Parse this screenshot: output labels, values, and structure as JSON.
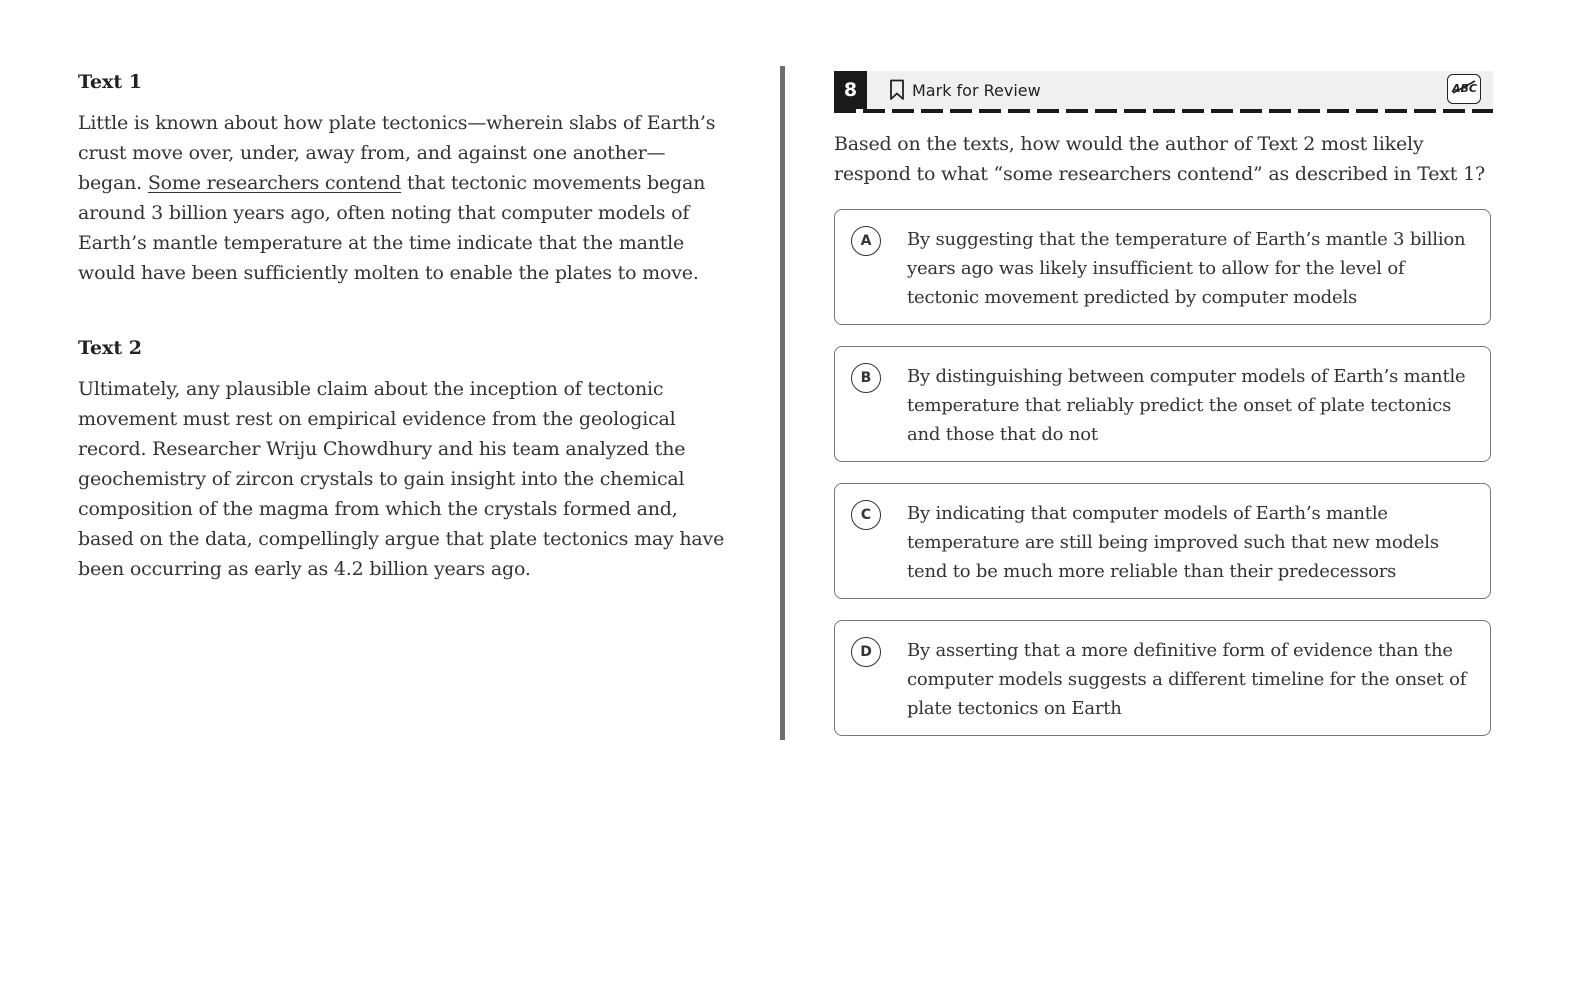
{
  "passage": {
    "text1": {
      "heading": "Text 1",
      "before_underline": "Little is known about how plate tectonics—wherein slabs of Earth’s crust move over, under, away from, and against one another—began. ",
      "underlined": "Some researchers contend",
      "after_underline": " that tectonic movements began around 3 billion years ago, often noting that computer models of Earth’s mantle temperature at the time indicate that the mantle would have been sufficiently molten to enable the plates to move."
    },
    "text2": {
      "heading": "Text 2",
      "body": "Ultimately, any plausible claim about the inception of tectonic movement must rest on empirical evidence from the geological record. Researcher Wriju Chowdhury and his team analyzed the geochemistry of zircon crystals to gain insight into the chemical composition of the magma from which the crystals formed and, based on the data, compellingly argue that plate tectonics may have been occurring as early as 4.2 billion years ago."
    }
  },
  "question": {
    "number": "8",
    "mark_for_review_label": "Mark for Review",
    "mark_for_review_icon": "bookmark-icon",
    "answer_eliminator_icon": "abc-strikethrough-icon",
    "answer_eliminator_label": "ABC",
    "stem": "Based on the texts, how would the author of Text 2 most likely respond to what “some researchers contend” as described in Text 1?",
    "choices": [
      {
        "letter": "A",
        "text": "By suggesting that the temperature of Earth’s mantle 3 billion years ago was likely insufficient to allow for the level of tectonic movement predicted by computer models"
      },
      {
        "letter": "B",
        "text": "By distinguishing between computer models of Earth’s mantle temperature that reliably predict the onset of plate tectonics and those that do not"
      },
      {
        "letter": "C",
        "text": "By indicating that computer models of Earth’s mantle temperature are still being improved such that new models tend to be much more reliable than their predecessors"
      },
      {
        "letter": "D",
        "text": "By asserting that a more definitive form of evidence than the computer models suggests a different timeline for the onset of plate tectonics on Earth"
      }
    ]
  },
  "colors": {
    "header_bar": "#f0f0f0",
    "question_number_bg": "#1a1a1a",
    "divider": "#6e6e6e",
    "choice_border": "#777777",
    "text": "#333333"
  }
}
